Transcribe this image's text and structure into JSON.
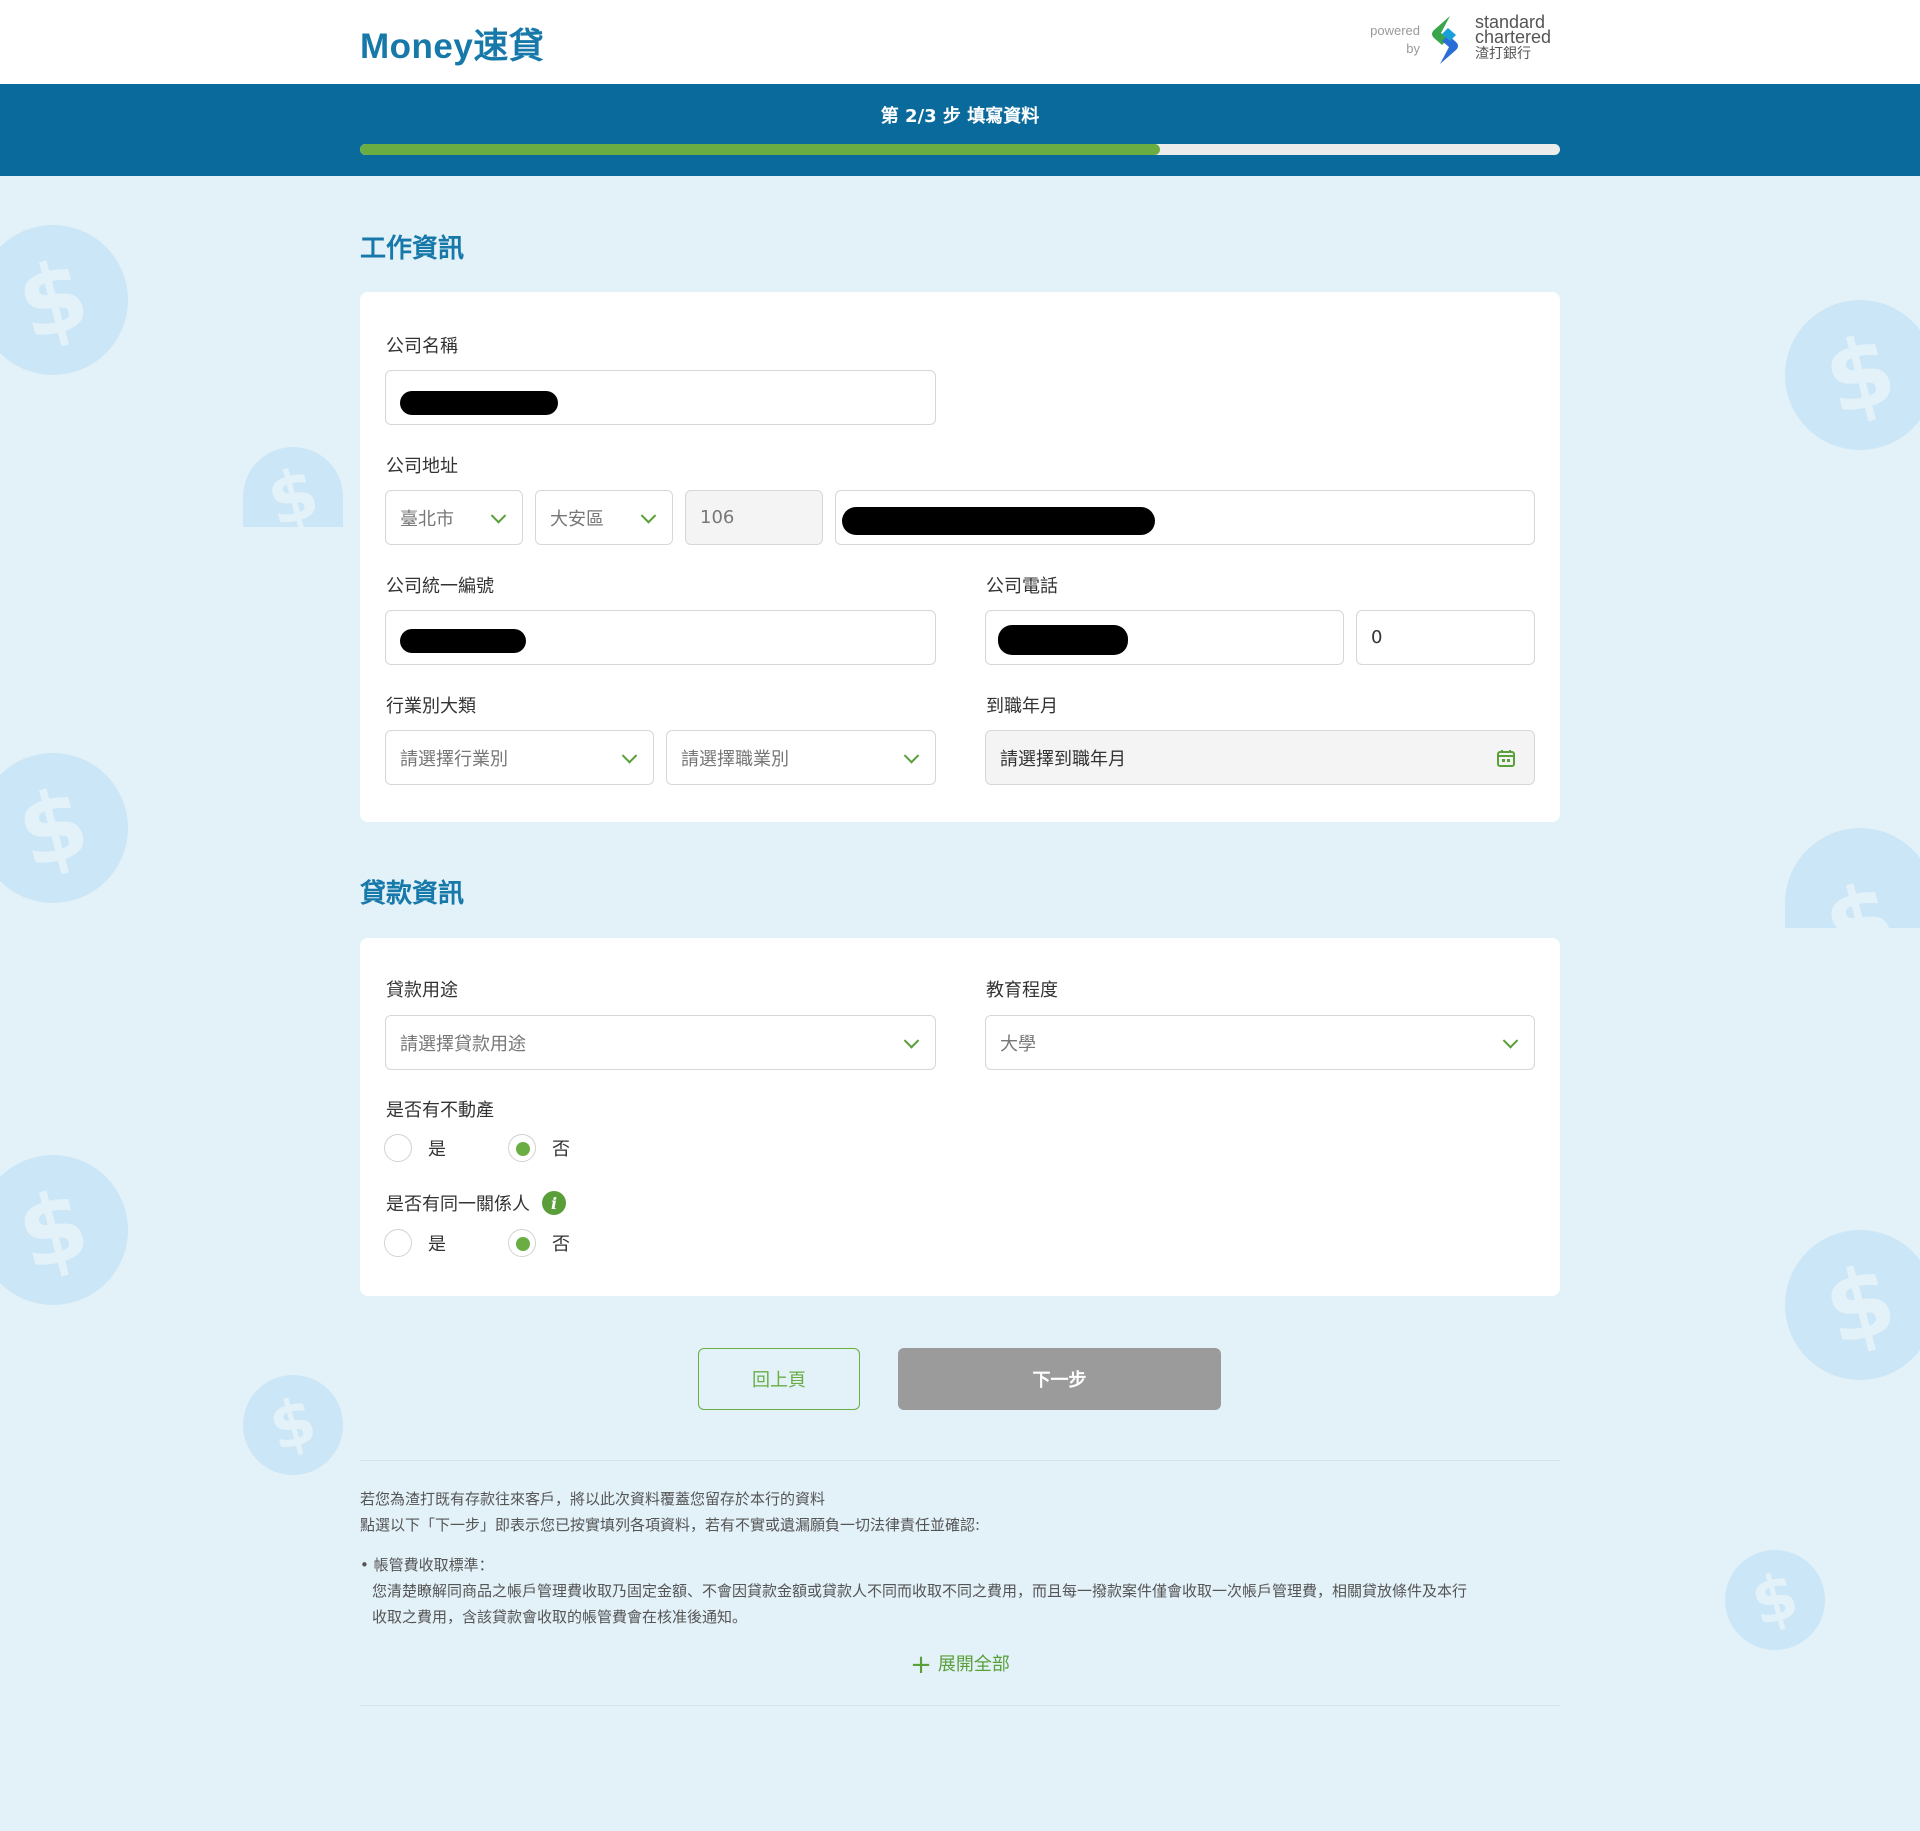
{
  "header": {
    "brand": "Money速貸",
    "powered": "powered",
    "by": "by",
    "sc_en1": "standard",
    "sc_en2": "chartered",
    "sc_zh": "渣打銀行"
  },
  "progress": {
    "step_text": "第 2/3 步 填寫資料",
    "fraction": 0.667
  },
  "work_info": {
    "title": "工作資訊",
    "company_name_label": "公司名稱",
    "company_address_label": "公司地址",
    "city": "臺北市",
    "district": "大安區",
    "zip": "106",
    "tax_id_label": "公司統一編號",
    "phone_label": "公司電話",
    "phone_ext": "0",
    "industry_label": "行業別大類",
    "industry_placeholder": "請選擇行業別",
    "job_placeholder": "請選擇職業別",
    "start_date_label": "到職年月",
    "start_date_placeholder": "請選擇到職年月"
  },
  "loan_info": {
    "title": "貸款資訊",
    "purpose_label": "貸款用途",
    "purpose_placeholder": "請選擇貸款用途",
    "education_label": "教育程度",
    "education_value": "大學",
    "real_estate_label": "是否有不動產",
    "related_label": "是否有同一關係人",
    "yes": "是",
    "no": "否",
    "real_estate_selected": "否",
    "related_selected": "否"
  },
  "buttons": {
    "back": "回上頁",
    "next": "下一步"
  },
  "notice": {
    "line1": "若您為渣打既有存款往來客戶，將以此次資料覆蓋您留存於本行的資料",
    "line2": "點選以下「下一步」即表示您已按實填列各項資料，若有不實或遺漏願負一切法律責任並確認:",
    "bullet_title": "• 帳管費收取標準：",
    "bullet_text1": "您清楚瞭解同商品之帳戶管理費收取乃固定金額、不會因貸款金額或貸款人不同而收取不同之費用，而且每一撥款案件僅會收取一次帳戶管理費，相關貸放條件及本行",
    "bullet_text2": "收取之費用，含該貸款會收取的帳管費會在核准後通知。",
    "expand": "展開全部"
  },
  "colors": {
    "brand_blue": "#1779a9",
    "band_blue": "#0a6a9b",
    "accent_green": "#6aad43",
    "page_bg": "#e3f1f9",
    "next_disabled": "#9b9b9b"
  }
}
